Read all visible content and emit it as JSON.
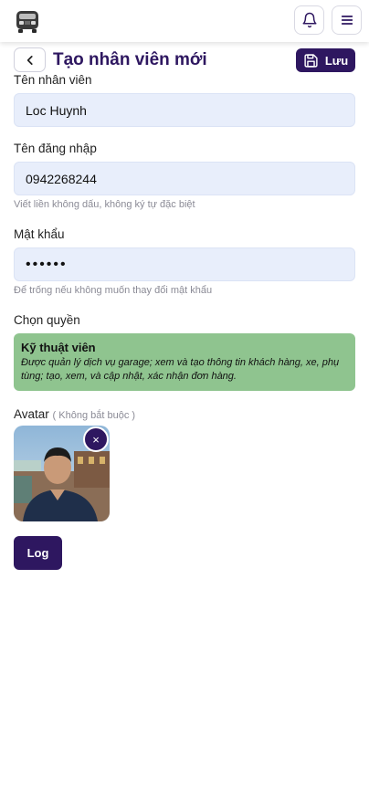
{
  "header": {
    "logo_icon": "car-logo-icon",
    "notification_icon": "bell-icon",
    "menu_icon": "hamburger-menu-icon"
  },
  "page": {
    "title": "Tạo nhân viên mới",
    "back_icon": "chevron-left-icon",
    "save_label": "Lưu",
    "save_icon": "floppy-disk-icon"
  },
  "form": {
    "employee_name_label": "Tên nhân viên",
    "employee_name_value": "Loc Huynh",
    "username_label": "Tên đăng nhập",
    "username_value": "0942268244",
    "username_hint": "Viết liền không dấu, không ký tự đặc biệt",
    "password_label": "Mật khẩu",
    "password_value": "••••••",
    "password_hint": "Để trống nếu không muốn thay đổi mật khẩu",
    "role_label": "Chọn quyền",
    "role_title": "Kỹ thuật viên",
    "role_description": "Được quản lý dịch vụ garage; xem và tạo thông tin khách hàng, xe, phụ tùng; tạo, xem, và cập nhật, xác nhận đơn hàng.",
    "avatar_label": "Avatar",
    "avatar_optional": "( Không bắt buộc )",
    "avatar_remove_label": "×",
    "log_button_label": "Log"
  },
  "colors": {
    "primary": "#2e1760",
    "input_bg": "#e8eefb",
    "role_bg": "#8fc48f"
  }
}
